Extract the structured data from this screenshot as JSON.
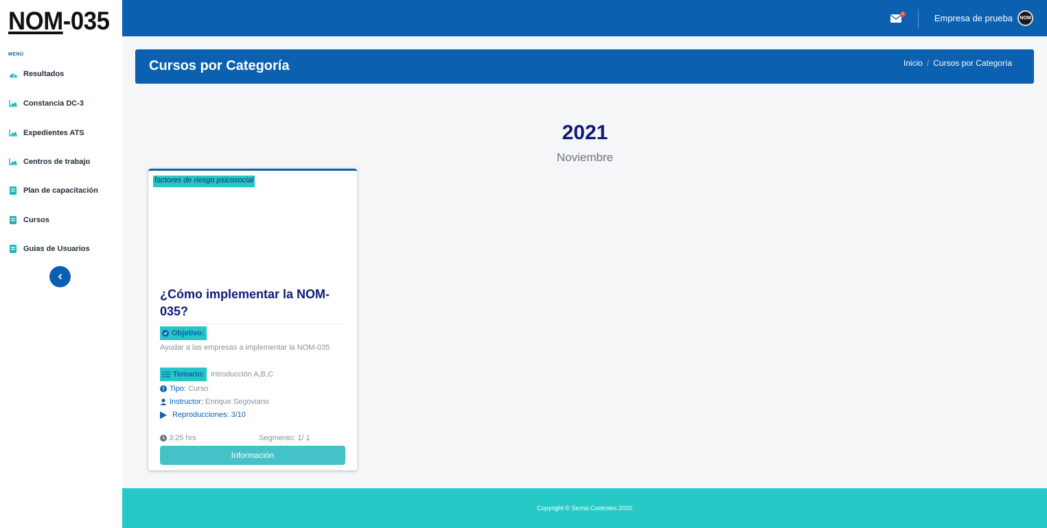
{
  "brand": {
    "logo_part1": "NOM",
    "logo_part2": "-035"
  },
  "sidebar": {
    "menu_label": "MENÚ",
    "items": [
      {
        "label": "Resultados",
        "icon": "dashboard-icon"
      },
      {
        "label": "Constancia DC-3",
        "icon": "chart-area-icon"
      },
      {
        "label": "Expedientes ATS",
        "icon": "chart-area-icon"
      },
      {
        "label": "Centros de trabajo",
        "icon": "chart-area-icon"
      },
      {
        "label": "Plan de capacitación",
        "icon": "book-icon"
      },
      {
        "label": "Cursos",
        "icon": "book-icon"
      },
      {
        "label": "Guias de Usuarios",
        "icon": "book-icon"
      }
    ]
  },
  "topbar": {
    "mail_count": "0",
    "company": "Empresa de prueba",
    "avatar_text": "NOM"
  },
  "page_header": {
    "title": "Cursos por Categoría",
    "breadcrumb": [
      "Inicio",
      "Cursos por Categoría"
    ]
  },
  "period": {
    "year": "2021",
    "month": "Noviembre"
  },
  "course_card": {
    "category": "factores de riesgo psicosocial",
    "title": "¿Cómo implementar la NOM-035?",
    "objective_label": "Objetivo:",
    "objective_text": "Ayudar a las empresas a implementar la NOM-035",
    "topics_label": "Temario:",
    "topics_text": "Introducción A,B,C",
    "type_label": "Tipo:",
    "type_value": "Curso",
    "instructor_label": "Instructor:",
    "instructor_value": "Enrique Segoviano",
    "plays_label": "Reproducciones: 3/10",
    "duration": "3:25 hrs",
    "segment": "Segmento: 1/ 1",
    "button_label": "Información"
  },
  "footer": {
    "copyright": "Copyright © Sicma Controles 2020"
  },
  "colors": {
    "primary": "#0b61b0",
    "accent": "#26c9c5",
    "title": "#0d1a78"
  }
}
